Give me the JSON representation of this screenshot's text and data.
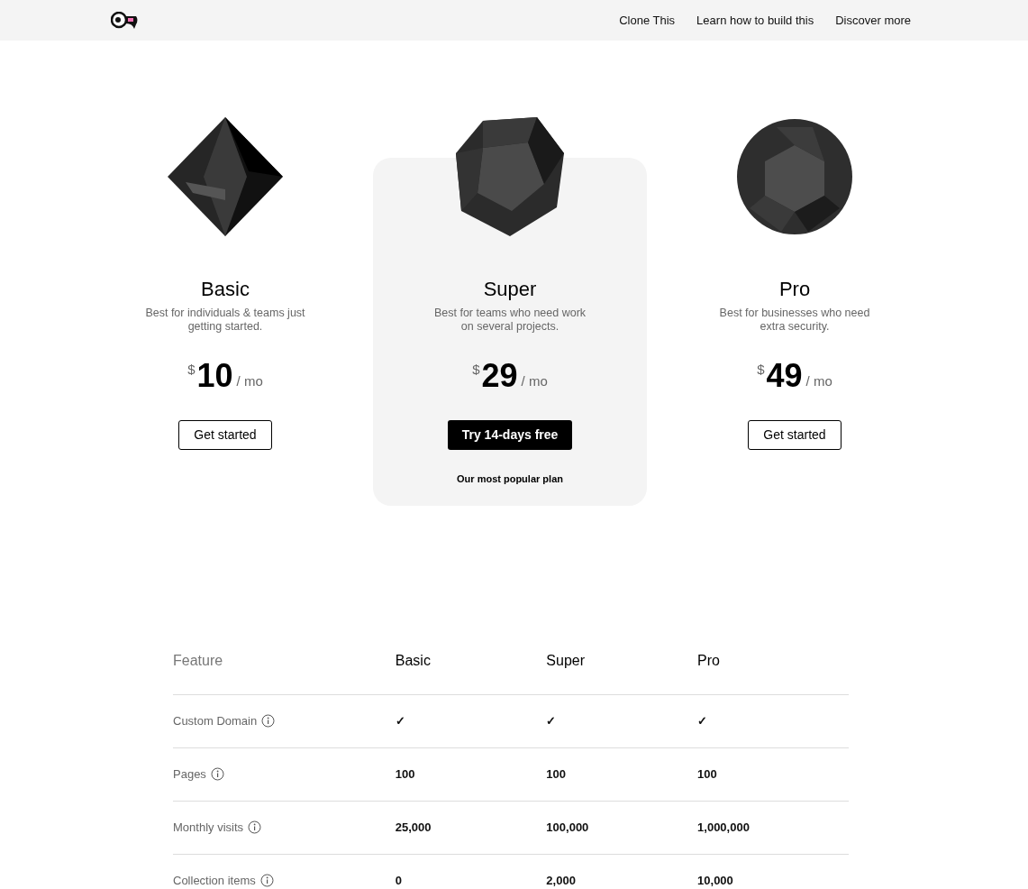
{
  "nav": {
    "links": [
      "Clone This",
      "Learn how to build this",
      "Discover more"
    ]
  },
  "plans": [
    {
      "name": "Basic",
      "kind": "octahedron",
      "description": "Best for individuals & teams just getting started.",
      "currency": "$",
      "price": "10",
      "period": "/ mo",
      "button": {
        "label": "Get started",
        "primary": false
      }
    },
    {
      "name": "Super",
      "kind": "dodecahedron",
      "description": "Best for teams who need work on several projects.",
      "currency": "$",
      "price": "29",
      "period": "/ mo",
      "button": {
        "label": "Try 14-days free",
        "primary": true
      },
      "note": "Our most popular plan"
    },
    {
      "name": "Pro",
      "kind": "faceted-sphere",
      "description": "Best for businesses who need extra security.",
      "currency": "$",
      "price": "49",
      "period": "/ mo",
      "button": {
        "label": "Get started",
        "primary": false
      }
    }
  ],
  "table": {
    "columns": [
      "Feature",
      "Basic",
      "Super",
      "Pro"
    ],
    "rows": [
      {
        "feature": "Custom Domain",
        "values": [
          "✓",
          "✓",
          "✓"
        ]
      },
      {
        "feature": "Pages",
        "values": [
          "100",
          "100",
          "100"
        ]
      },
      {
        "feature": "Monthly visits",
        "values": [
          "25,000",
          "100,000",
          "1,000,000"
        ]
      },
      {
        "feature": "Collection items",
        "values": [
          "0",
          "2,000",
          "10,000"
        ]
      }
    ]
  }
}
